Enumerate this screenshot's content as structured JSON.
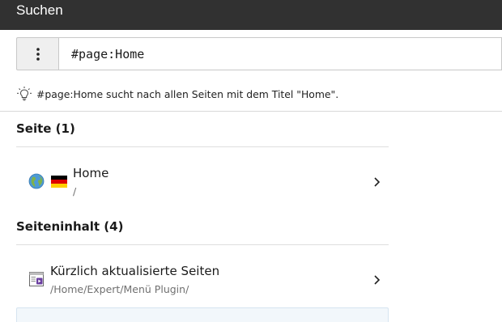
{
  "header": {
    "title": "Suchen"
  },
  "search": {
    "value": "#page:Home",
    "placeholder": ""
  },
  "hint": {
    "text": "#page:Home sucht nach allen Seiten mit dem Titel \"Home\"."
  },
  "sections": [
    {
      "title": "Seite (1)",
      "results": [
        {
          "title": "Home",
          "path": "/",
          "icons": [
            "globe-icon",
            "german-flag-icon"
          ]
        }
      ]
    },
    {
      "title": "Seiteninhalt (4)",
      "results": [
        {
          "title": "Kürzlich aktualisierte Seiten",
          "path": "/Home/Expert/Menü Plugin/",
          "icons": [
            "content-plugin-icon"
          ]
        },
        {
          "title": "",
          "path": ""
        }
      ]
    }
  ],
  "colors": {
    "header_bg": "#313131",
    "accent_partial_bg": "#f2f7fb"
  }
}
